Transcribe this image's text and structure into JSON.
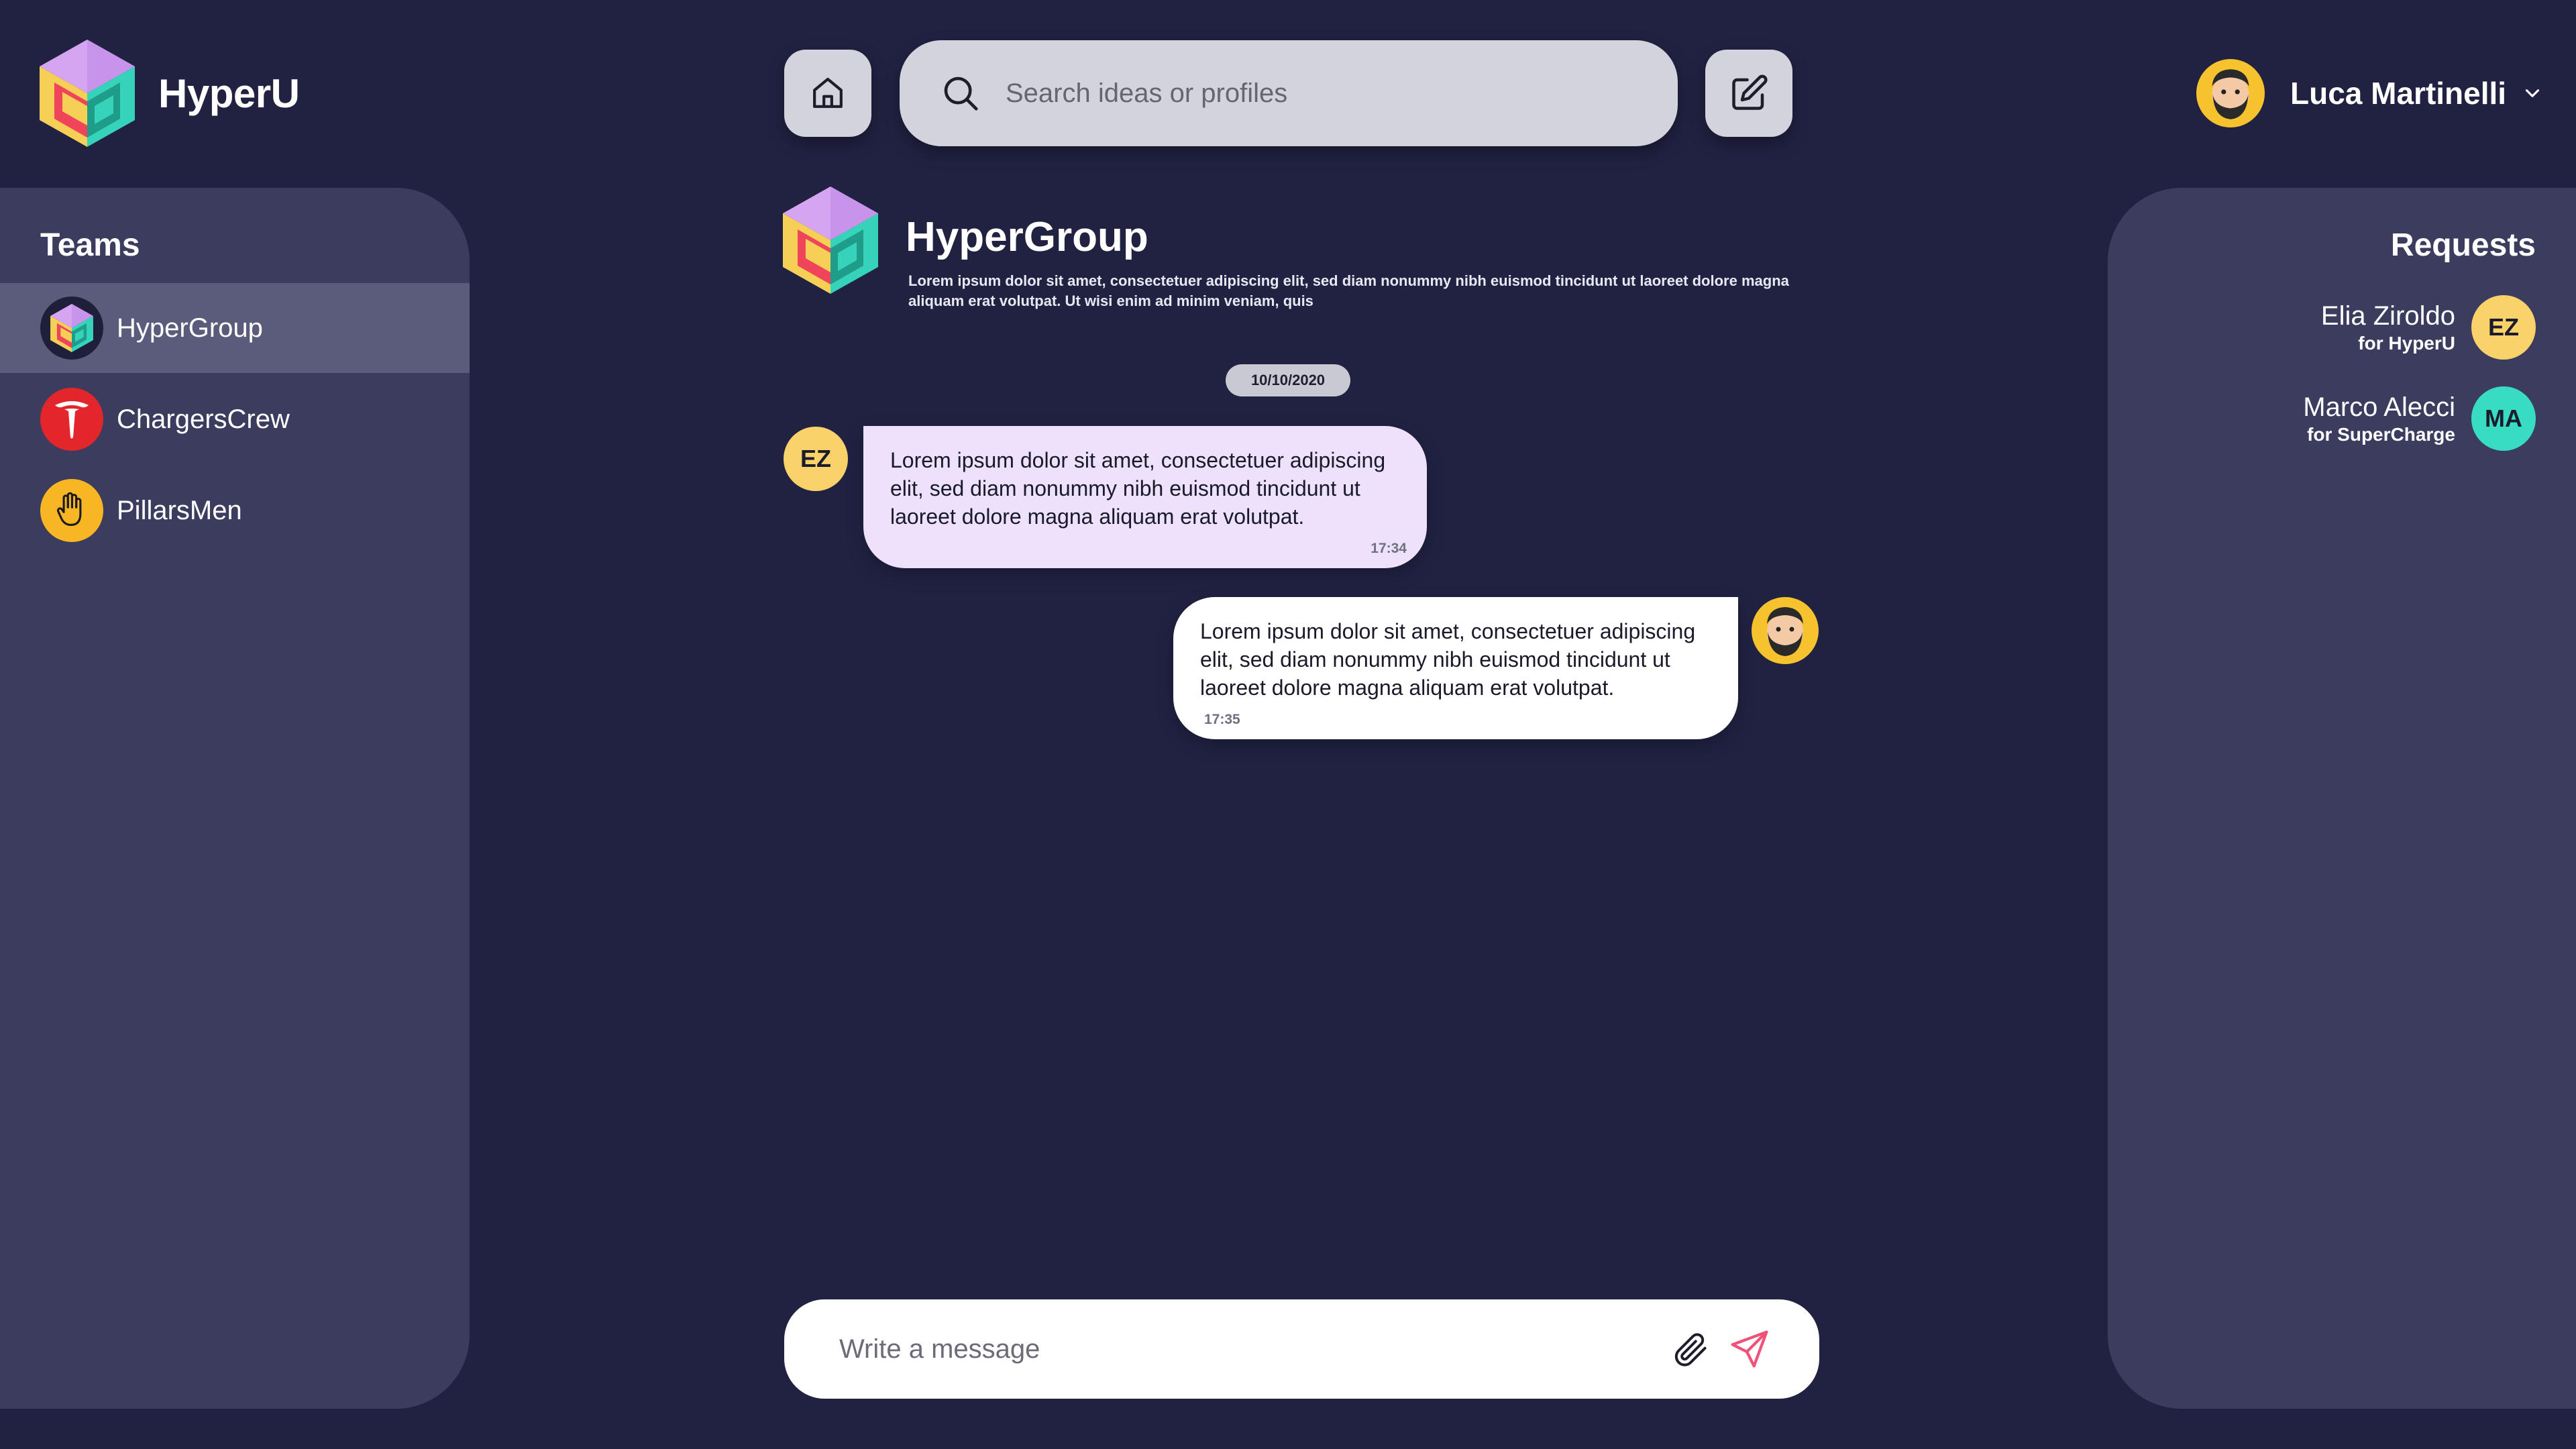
{
  "app": {
    "name": "HyperU"
  },
  "header": {
    "search_placeholder": "Search ideas or profiles",
    "home_icon": "home-icon",
    "compose_icon": "edit-icon",
    "user": {
      "name": "Luca Martinelli"
    }
  },
  "teams": {
    "title": "Teams",
    "items": [
      {
        "label": "HyperGroup",
        "active": true
      },
      {
        "label": "ChargersCrew",
        "active": false
      },
      {
        "label": "PillarsMen",
        "active": false
      }
    ]
  },
  "requests": {
    "title": "Requests",
    "items": [
      {
        "name": "Elia Ziroldo",
        "for": "for HyperU",
        "initials": "EZ",
        "color": "#f9d26a"
      },
      {
        "name": "Marco Alecci",
        "for": "for SuperCharge",
        "initials": "MA",
        "color": "#37dcc3"
      }
    ]
  },
  "group": {
    "name": "HyperGroup",
    "description": "Lorem ipsum dolor sit amet, consectetuer adipiscing elit, sed diam nonummy nibh euismod tincidunt ut laoreet dolore magna aliquam erat volutpat. Ut wisi enim ad minim veniam, quis"
  },
  "chat": {
    "date": "10/10/2020",
    "messages": [
      {
        "author_initials": "EZ",
        "text": "Lorem ipsum dolor sit amet, consectetuer adipiscing elit, sed diam nonummy nibh euismod tincidunt ut laoreet dolore magna aliquam erat volutpat.",
        "time": "17:34"
      },
      {
        "author": "me",
        "text": "Lorem ipsum dolor sit amet, consectetuer adipiscing elit, sed diam nonummy nibh euismod tincidunt ut laoreet dolore magna aliquam erat volutpat.",
        "time": "17:35"
      }
    ],
    "composer_placeholder": "Write a message"
  },
  "colors": {
    "background": "#212242",
    "panel": "#3b3c5e",
    "active_item": "#5b5c7b",
    "incoming_bubble": "#ede1fb",
    "outgoing_bubble": "#ffffff",
    "send_accent": "#f0527a",
    "avatar_yellow": "#f9d26a"
  }
}
